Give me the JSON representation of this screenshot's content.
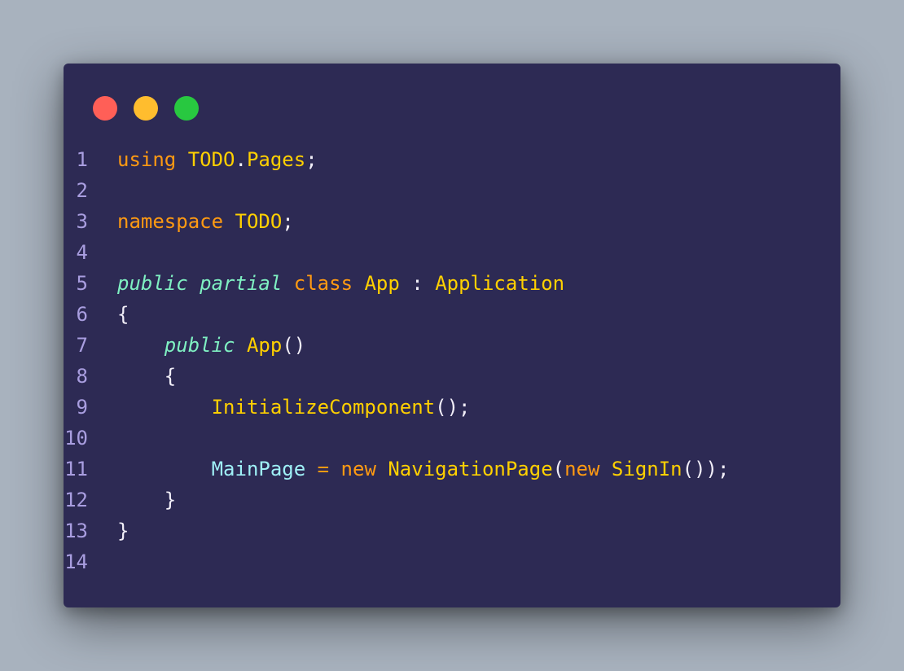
{
  "window": {
    "controls": [
      {
        "name": "close",
        "color": "#ff5f57"
      },
      {
        "name": "minimize",
        "color": "#ffbd2e"
      },
      {
        "name": "maximize",
        "color": "#28c840"
      }
    ]
  },
  "colors": {
    "background": "#a8b2be",
    "editor_background": "#2d2a54",
    "line_number": "#a99ee0",
    "keyword": "#ff9a12",
    "type": "#ffd000",
    "modifier": "#7ff0c2",
    "property": "#9ff0f6",
    "punctuation": "#f1eef8"
  },
  "code": {
    "language": "csharp",
    "lines": [
      {
        "n": "1",
        "tokens": [
          {
            "t": "using",
            "c": "kw"
          },
          {
            "t": " ",
            "c": "pn"
          },
          {
            "t": "TODO",
            "c": "ty"
          },
          {
            "t": ".",
            "c": "pn"
          },
          {
            "t": "Pages",
            "c": "ty"
          },
          {
            "t": ";",
            "c": "pn"
          }
        ]
      },
      {
        "n": "2",
        "tokens": []
      },
      {
        "n": "3",
        "tokens": [
          {
            "t": "namespace",
            "c": "kw"
          },
          {
            "t": " ",
            "c": "pn"
          },
          {
            "t": "TODO",
            "c": "ty"
          },
          {
            "t": ";",
            "c": "pn"
          }
        ]
      },
      {
        "n": "4",
        "tokens": []
      },
      {
        "n": "5",
        "tokens": [
          {
            "t": "public",
            "c": "mod"
          },
          {
            "t": " ",
            "c": "pn"
          },
          {
            "t": "partial",
            "c": "mod"
          },
          {
            "t": " ",
            "c": "pn"
          },
          {
            "t": "class",
            "c": "kw"
          },
          {
            "t": " ",
            "c": "pn"
          },
          {
            "t": "App",
            "c": "ty"
          },
          {
            "t": " : ",
            "c": "pn"
          },
          {
            "t": "Application",
            "c": "ty"
          }
        ]
      },
      {
        "n": "6",
        "tokens": [
          {
            "t": "{",
            "c": "pn"
          }
        ]
      },
      {
        "n": "7",
        "tokens": [
          {
            "t": "    ",
            "c": "pn"
          },
          {
            "t": "public",
            "c": "mod"
          },
          {
            "t": " ",
            "c": "pn"
          },
          {
            "t": "App",
            "c": "ty"
          },
          {
            "t": "()",
            "c": "pn"
          }
        ]
      },
      {
        "n": "8",
        "tokens": [
          {
            "t": "    {",
            "c": "pn"
          }
        ]
      },
      {
        "n": "9",
        "tokens": [
          {
            "t": "        ",
            "c": "pn"
          },
          {
            "t": "InitializeComponent",
            "c": "ty"
          },
          {
            "t": "();",
            "c": "pn"
          }
        ]
      },
      {
        "n": "10",
        "tokens": []
      },
      {
        "n": "11",
        "tokens": [
          {
            "t": "        ",
            "c": "pn"
          },
          {
            "t": "MainPage",
            "c": "prop"
          },
          {
            "t": " ",
            "c": "pn"
          },
          {
            "t": "=",
            "c": "kw"
          },
          {
            "t": " ",
            "c": "pn"
          },
          {
            "t": "new",
            "c": "kw"
          },
          {
            "t": " ",
            "c": "pn"
          },
          {
            "t": "NavigationPage",
            "c": "ty"
          },
          {
            "t": "(",
            "c": "pn"
          },
          {
            "t": "new",
            "c": "kw"
          },
          {
            "t": " ",
            "c": "pn"
          },
          {
            "t": "SignIn",
            "c": "ty"
          },
          {
            "t": "());",
            "c": "pn"
          }
        ]
      },
      {
        "n": "12",
        "tokens": [
          {
            "t": "    }",
            "c": "pn"
          }
        ]
      },
      {
        "n": "13",
        "tokens": [
          {
            "t": "}",
            "c": "pn"
          }
        ]
      },
      {
        "n": "14",
        "tokens": []
      }
    ]
  }
}
